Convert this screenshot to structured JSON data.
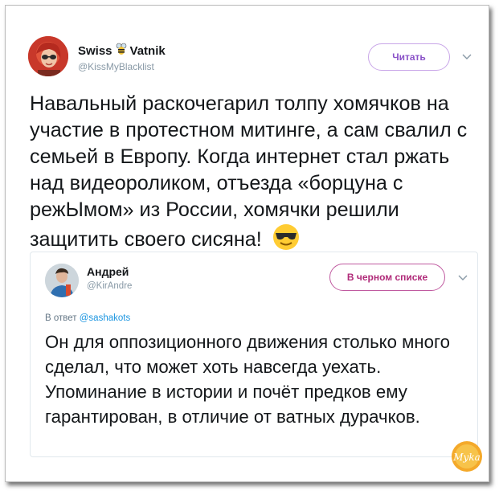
{
  "tweet": {
    "display_name_part1": "Swiss",
    "display_name_part2": "Vatnik",
    "handle": "@KissMyBlacklist",
    "follow_label": "Читать",
    "text": "Навальный раскочегарил толпу хомячков на участие в протестном митинге, а сам свалил с семьей в Европу. Когда интернет стал ржать над видеороликом, отъезда «борцуна с режЫмом» из России, хомячки решили защитить своего сисяна!",
    "emoji": "sunglasses-emoji"
  },
  "quote": {
    "display_name": "Андрей",
    "handle": "@KirAndre",
    "blocked_label": "В черном списке",
    "reply_prefix": "В ответ",
    "reply_to": "@sashakots",
    "text": "Он для оппозиционного движения столько много сделал, что может хоть навсегда уехать. Упоминание в истории и почёт предков ему гарантирован, в отличие от ватных дурачков."
  },
  "watermark": {
    "text": "Мyka"
  },
  "colors": {
    "follow_border": "#c9a6e8",
    "follow_text": "#8a52c8",
    "blocked_border": "#c05aa0",
    "blocked_text": "#b02a79",
    "handle_gray": "#8899a6",
    "link_blue": "#1b95e0"
  }
}
